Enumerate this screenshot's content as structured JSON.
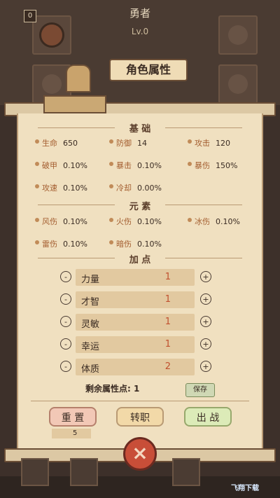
{
  "hero": {
    "title": "勇者",
    "level": "Lv.0",
    "badge": "0"
  },
  "panel": {
    "title": "角色属性"
  },
  "sections": {
    "basic": "基 础",
    "element": "元 素",
    "points": "加 点"
  },
  "basic_stats": [
    {
      "label": "生命",
      "value": "650"
    },
    {
      "label": "防御",
      "value": "14"
    },
    {
      "label": "攻击",
      "value": "120"
    },
    {
      "label": "破甲",
      "value": "0.10%"
    },
    {
      "label": "暴击",
      "value": "0.10%"
    },
    {
      "label": "暴伤",
      "value": "150%"
    },
    {
      "label": "攻速",
      "value": "0.10%"
    },
    {
      "label": "冷却",
      "value": "0.00%"
    }
  ],
  "element_stats": [
    {
      "label": "风伤",
      "value": "0.10%"
    },
    {
      "label": "火伤",
      "value": "0.10%"
    },
    {
      "label": "冰伤",
      "value": "0.10%"
    },
    {
      "label": "雷伤",
      "value": "0.10%"
    },
    {
      "label": "暗伤",
      "value": "0.10%"
    }
  ],
  "points": [
    {
      "label": "力量",
      "value": "1"
    },
    {
      "label": "才智",
      "value": "1"
    },
    {
      "label": "灵敏",
      "value": "1"
    },
    {
      "label": "幸运",
      "value": "1"
    },
    {
      "label": "体质",
      "value": "2"
    }
  ],
  "minus": "-",
  "plus": "+",
  "remaining": "剩余属性点: 1",
  "save": "保存",
  "buttons": {
    "reset": "重 置",
    "job": "转职",
    "fight": "出 战"
  },
  "count": "5",
  "close": "×",
  "watermark": "飞翔下载"
}
